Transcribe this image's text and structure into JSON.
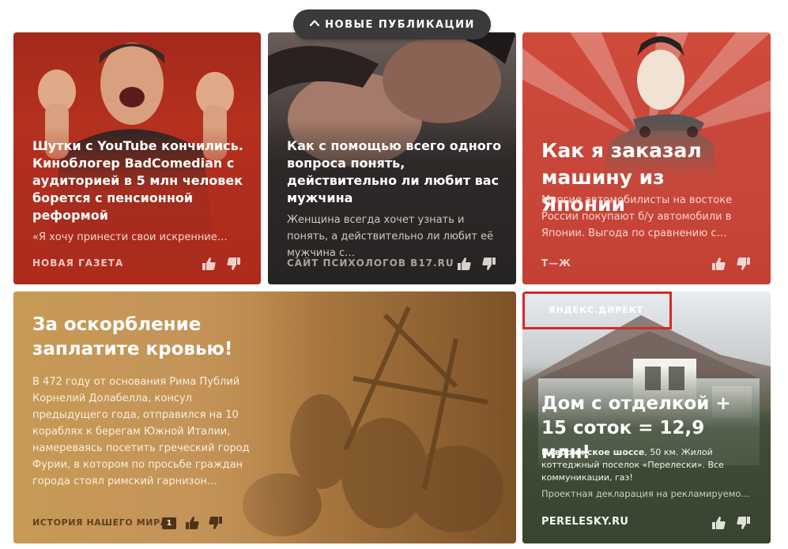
{
  "header": {
    "new_publications_label": "НОВЫЕ ПУБЛИКАЦИИ",
    "new_publications_icon": "chevron-up-icon"
  },
  "cards": [
    {
      "title": "Шутки с YouTube кончились. Киноблогер BadComedian с аудиторией в 5 млн человек борется с пенсионной реформой",
      "snippet": "«Я хочу принести свои искренние…",
      "source": "НОВАЯ ГАЗЕТА",
      "bg_color": "#b02e1f"
    },
    {
      "title": "Как с помощью всего одного вопроса понять, действительно ли любит вас мужчина",
      "snippet": "Женщина всегда хочет узнать и понять, а действительно ли любит её мужчина с…",
      "source": "САЙТ ПСИХОЛОГОВ B17.RU",
      "bg_color": "#2b2827"
    },
    {
      "title": "Как я заказал машину из Японии",
      "snippet": "Многие автомобилисты на востоке России покупают б/у автомобили в Японии. Выгода по сравнению с…",
      "source": "Т—Ж",
      "bg_color": "#c9473a"
    },
    {
      "title": "За оскорбление заплатите кровью!",
      "snippet": "В 472 году от основания Рима Публий Корнелий Долабелла, консул предыдущего года, отправился на 10 кораблях к берегам Южной Италии, намереваясь посетить греческий город Фурии, в котором по просьбе граждан города стоял римский гарнизон…",
      "source": "ИСТОРИЯ НАШЕГО МИРА",
      "comments_count": "1",
      "bg_color": "#c4945a"
    },
    {
      "ad_label": "ЯНДЕКС.ДИРЕКТ",
      "title": "Дом с отделкой + 15 соток = 12,9 млн!",
      "snippet_bold": "Новорижское шоссе",
      "snippet_rest": ", 50 км. Жилой коттеджный поселок «Перелески». Все коммуникации, газ!",
      "disclaimer": "Проектная декларация на рекламируемо…",
      "source": "PERELESKY.RU",
      "bg_color": "#3e4a34",
      "highlight_color": "#d42a2a"
    }
  ]
}
